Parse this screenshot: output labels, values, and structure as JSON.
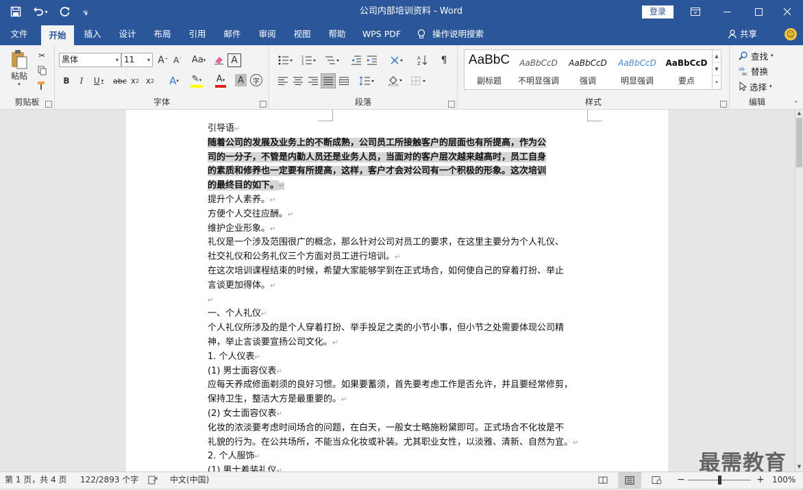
{
  "window": {
    "title": "公司内部培训资料  -  Word",
    "login_label": "登录"
  },
  "qat": {
    "save": "save-icon",
    "undo": "undo-icon",
    "redo": "redo-icon",
    "customize": "customize-icon"
  },
  "tabs": [
    {
      "label": "文件"
    },
    {
      "label": "开始"
    },
    {
      "label": "插入"
    },
    {
      "label": "设计"
    },
    {
      "label": "布局"
    },
    {
      "label": "引用"
    },
    {
      "label": "邮件"
    },
    {
      "label": "审阅"
    },
    {
      "label": "视图"
    },
    {
      "label": "帮助"
    },
    {
      "label": "WPS PDF"
    },
    {
      "label": "操作说明搜索"
    }
  ],
  "share_label": "共享",
  "ribbon": {
    "clipboard": {
      "label": "剪贴板",
      "paste": "粘贴"
    },
    "font": {
      "label": "字体",
      "font_name": "黑体",
      "font_size": "11"
    },
    "paragraph": {
      "label": "段落"
    },
    "styles": {
      "label": "样式",
      "items": [
        {
          "preview": "AaBbC",
          "name": "副标题"
        },
        {
          "preview": "AaBbCcD",
          "name": "不明显强调"
        },
        {
          "preview": "AaBbCcD",
          "name": "强调"
        },
        {
          "preview": "AaBbCcD",
          "name": "明显强调"
        },
        {
          "preview": "AaBbCcD",
          "name": "要点"
        }
      ]
    },
    "editing": {
      "label": "编辑",
      "find": "查找",
      "replace": "替换",
      "select": "选择"
    }
  },
  "document": {
    "lines": [
      {
        "t": "引导语",
        "hl": false
      },
      {
        "t": "随着公司的发展及业务上的不断成熟，公司员工所接触客户的层面也有所提高，作为公",
        "hl": true,
        "bold": true,
        "nomark": true
      },
      {
        "t": "司的一分子，不管是内勤人员还是业务人员，当面对的客户层次越来越高时，员工自身",
        "hl": true,
        "bold": true,
        "nomark": true
      },
      {
        "t": "的素质和修养也一定要有所提高，这样，客户才会对公司有一个积极的形象。这次培训",
        "hl": true,
        "bold": true,
        "nomark": true
      },
      {
        "t": "的最终目的如下。",
        "hl": true,
        "bold": true
      },
      {
        "t": "提升个人素养。",
        "hl": false
      },
      {
        "t": "方便个人交往应酬。",
        "hl": false
      },
      {
        "t": "维护企业形象。",
        "hl": false
      },
      {
        "t": "礼仪是一个涉及范围很广的概念，那么针对公司对员工的要求，在这里主要分为个人礼仪、",
        "hl": false,
        "nomark": true
      },
      {
        "t": "社交礼仪和公务礼仪三个方面对员工进行培训。",
        "hl": false
      },
      {
        "t": "在这次培训课程结束的时候，希望大家能够学到在正式场合，如何使自己的穿着打扮、举止",
        "hl": false,
        "nomark": true
      },
      {
        "t": "言谈更加得体。",
        "hl": false
      },
      {
        "t": "",
        "hl": false
      },
      {
        "t": "一、个人礼仪",
        "hl": false
      },
      {
        "t": "个人礼仪所涉及的是个人穿着打扮、举手投足之类的小节小事，但小节之处需要体现公司精",
        "hl": false,
        "nomark": true
      },
      {
        "t": "神，举止言谈要宣扬公司文化。",
        "hl": false
      },
      {
        "t": "1. 个人仪表",
        "hl": false
      },
      {
        "t": "(1) 男士面容仪表",
        "hl": false
      },
      {
        "t": "应每天养成修面剃须的良好习惯。如果要蓄须，首先要考虑工作是否允许，并且要经常修剪，",
        "hl": false,
        "nomark": true
      },
      {
        "t": "保持卫生，整洁大方是最重要的。",
        "hl": false
      },
      {
        "t": "(2) 女士面容仪表",
        "hl": false
      },
      {
        "t": "化妆的浓淡要考虑时间场合的问题，在白天，一般女士略施粉黛即可。正式场合不化妆是不",
        "hl": false,
        "nomark": true
      },
      {
        "t": "礼貌的行为。在公共场所，不能当众化妆或补装。尤其职业女性，以淡雅、清新、自然为宜。",
        "hl": false
      },
      {
        "t": "2. 个人服饰",
        "hl": false
      },
      {
        "t": "(1) 男士着装礼仪",
        "hl": false
      }
    ]
  },
  "status": {
    "page": "第 1 页，共 4 页",
    "words": "122/2893 个字",
    "lang": "中文(中国)",
    "zoom": "100%",
    "zoom_level": 1.0
  },
  "watermark": "最需教育"
}
